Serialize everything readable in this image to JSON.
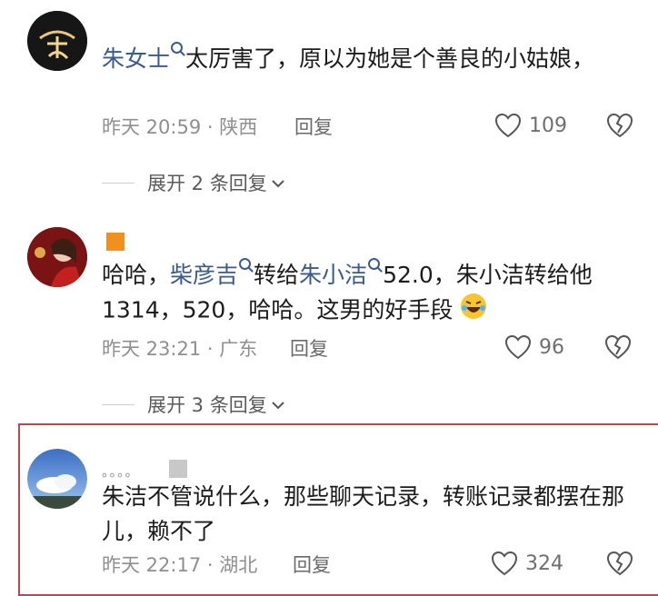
{
  "comments": [
    {
      "username": "",
      "body_link": "朱女士",
      "body_text": "太厉害了，原以为她是个善良的小姑娘，",
      "time_location": "昨天 20:59 · 陕西",
      "reply_label": "回复",
      "likes": "109",
      "expand_label": "展开 2 条回复"
    },
    {
      "username": "",
      "body_prefix": "哈哈，",
      "body_link1": "柴彦吉",
      "body_mid": "转给",
      "body_link2": "朱小洁",
      "body_text": "52.0，朱小洁转给他1314，520，哈哈。这男的好手段",
      "time_location": "昨天 23:21 · 广东",
      "reply_label": "回复",
      "likes": "96",
      "expand_label": "展开 3 条回复"
    },
    {
      "username": "。。。。",
      "body_text": "朱洁不管说什么，那些聊天记录，转账记录都摆在那儿，赖不了",
      "time_location": "昨天 22:17 · 湖北",
      "reply_label": "回复",
      "likes": "324"
    }
  ],
  "colors": {
    "link": "#3a5b8e",
    "badge": "#f0901e",
    "highlight_border": "#b8484b"
  },
  "icons": [
    "heart-icon",
    "broken-heart-icon",
    "chevron-down-icon",
    "search-mark-icon",
    "laughing-emoji-icon"
  ]
}
